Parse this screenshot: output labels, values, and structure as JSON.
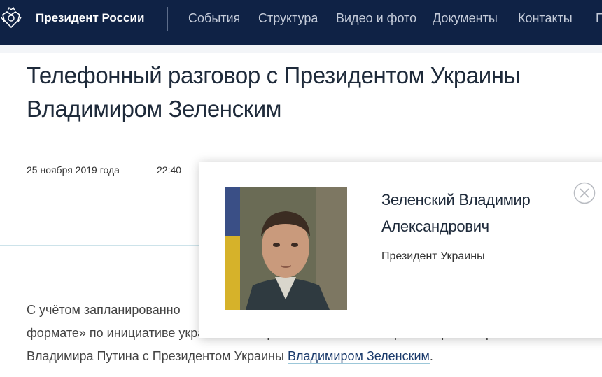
{
  "header": {
    "site_title": "Президент России",
    "nav": [
      "События",
      "Структура",
      "Видео и фото",
      "Документы",
      "Контакты",
      "П"
    ]
  },
  "article": {
    "title": "Телефонный разговор с Президентом Украины Владимиром Зеленским",
    "date": "25 ноября 2019 года",
    "time": "22:40",
    "body_line1": "С учётом запланированно",
    "body_line2": "формате» по инициативе украинской стороны состоялся телефонный разговор",
    "body_line3_prefix": "Владимира Путина с Президентом Украины ",
    "body_line3_link": "Владимиром Зеленским",
    "body_line3_suffix": "."
  },
  "popup": {
    "name": "Зеленский Владимир Александрович",
    "role": "Президент Украины"
  },
  "colors": {
    "header_bg": "#0f2245",
    "nav_text": "#c4cbd9",
    "link_underline": "#9cc7d9"
  }
}
